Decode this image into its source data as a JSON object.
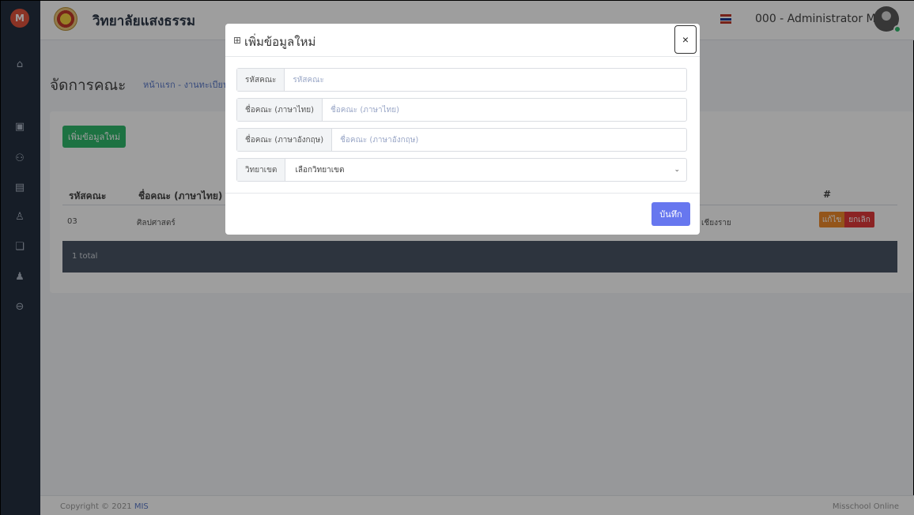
{
  "app": {
    "logo_letter": "M",
    "brand_name": "วิทยาลัยแสงธรรม",
    "user_name": "000 - Administrator MIS"
  },
  "sidebar": {
    "icons": [
      "home-icon",
      "document-icon",
      "users-group-icon",
      "calendar-icon",
      "user-icon",
      "file-stack-icon",
      "user-settings-icon",
      "logout-icon"
    ]
  },
  "page": {
    "title": "จัดการคณะ",
    "breadcrumb": "หน้าแรก  -  งานทะเบียน"
  },
  "card": {
    "add_button": "เพิ่มข้อมูลใหม่",
    "columns": [
      "รหัสคณะ",
      "ชื่อคณะ (ภาษาไทย)",
      "#"
    ],
    "rows": [
      {
        "code": "03",
        "name_th": "ศิลปศาสตร์",
        "campus": "เชียงราย"
      }
    ],
    "edit_label": "แก้ไข",
    "delete_label": "ยกเลิก",
    "total": "1 total"
  },
  "footer": {
    "copyright_prefix": "Copyright © 2021 ",
    "copyright_link": "MIS",
    "right_text": "Misschool Online"
  },
  "modal": {
    "title": "เพิ่มข้อมูลใหม่",
    "close": "×",
    "fields": [
      {
        "label": "รหัสคณะ",
        "placeholder": "รหัสคณะ"
      },
      {
        "label": "ชื่อคณะ (ภาษาไทย)",
        "placeholder": "ชื่อคณะ (ภาษาไทย)"
      },
      {
        "label": "ชื่อคณะ (ภาษาอังกฤษ)",
        "placeholder": "ชื่อคณะ (ภาษาอังกฤษ)"
      }
    ],
    "select": {
      "label": "วิทยาเขต",
      "value": "เลือกวิทยาเขต"
    },
    "save": "บันทึก"
  },
  "colors": {
    "sidebar": "#243040",
    "primary": "#6777ef",
    "success": "#2fb86b",
    "warning": "#ee8a2b",
    "danger": "#e0393b"
  }
}
